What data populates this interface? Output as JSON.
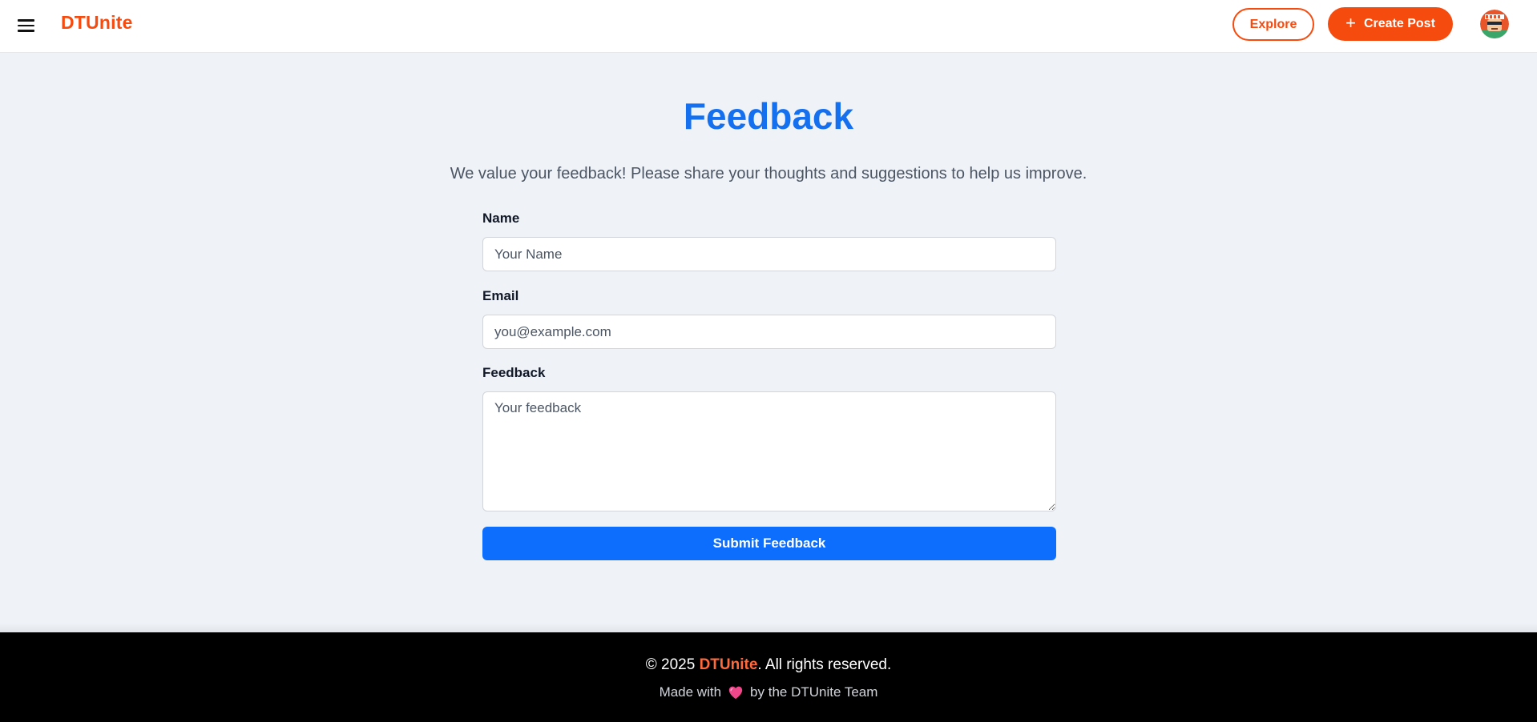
{
  "header": {
    "brand": "DTUnite",
    "explore_label": "Explore",
    "create_post_label": "Create Post",
    "menu_icon": "hamburger-menu-icon",
    "avatar_icon": "user-avatar"
  },
  "main": {
    "title": "Feedback",
    "subtitle": "We value your feedback! Please share your thoughts and suggestions to help us improve.",
    "name_label": "Name",
    "name_placeholder": "Your Name",
    "name_value": "",
    "email_label": "Email",
    "email_placeholder": "you@example.com",
    "email_value": "",
    "feedback_label": "Feedback",
    "feedback_placeholder": "Your feedback",
    "feedback_value": "",
    "submit_label": "Submit Feedback"
  },
  "footer": {
    "copyright_prefix": "© 2025 ",
    "copyright_brand": "DTUnite",
    "copyright_suffix": ". All rights reserved.",
    "made_with_prefix": "Made with",
    "made_with_suffix": "by the DTUnite Team",
    "heart_icon": "heart-icon"
  },
  "colors": {
    "brand": "#f64b0e",
    "primary": "#0d6efd",
    "title": "#1570ef",
    "background": "#eff3f8",
    "footer_bg": "#000000",
    "heart": "#f0468a"
  }
}
